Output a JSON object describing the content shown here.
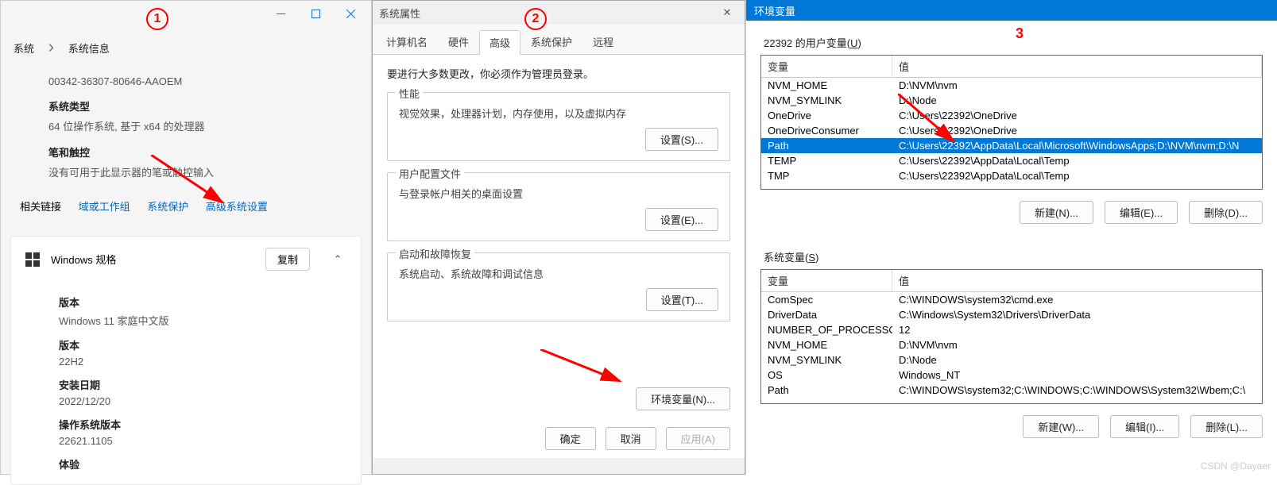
{
  "annotations": {
    "c1": "1",
    "c2": "2",
    "c3": "3"
  },
  "watermark": "CSDN @Dayaer",
  "win1": {
    "breadcrumb_a": "系统",
    "breadcrumb_b": "系统信息",
    "product_id": "00342-36307-80646-AAOEM",
    "type_label": "系统类型",
    "type_value": "64 位操作系统, 基于 x64 的处理器",
    "pen_label": "笔和触控",
    "pen_value": "没有可用于此显示器的笔或触控输入",
    "links_label": "相关链接",
    "link_domain": "域或工作组",
    "link_protect": "系统保护",
    "link_advanced": "高级系统设置",
    "card_title": "Windows 规格",
    "copy": "复制",
    "version_label": "版本",
    "version_value": "Windows 11 家庭中文版",
    "build_label": "版本",
    "build_value": "22H2",
    "date_label": "安装日期",
    "date_value": "2022/12/20",
    "os_label": "操作系统版本",
    "os_value": "22621.1105",
    "exp_label": "体验"
  },
  "win2": {
    "title": "系统属性",
    "tabs": {
      "t1": "计算机名",
      "t2": "硬件",
      "t3": "高级",
      "t4": "系统保护",
      "t5": "远程"
    },
    "admin_note": "要进行大多数更改，你必须作为管理员登录。",
    "perf": {
      "legend": "性能",
      "desc": "视觉效果，处理器计划，内存使用，以及虚拟内存",
      "btn": "设置(S)..."
    },
    "profile": {
      "legend": "用户配置文件",
      "desc": "与登录帐户相关的桌面设置",
      "btn": "设置(E)..."
    },
    "startup": {
      "legend": "启动和故障恢复",
      "desc": "系统启动、系统故障和调试信息",
      "btn": "设置(T)..."
    },
    "env_btn": "环境变量(N)...",
    "ok": "确定",
    "cancel": "取消",
    "apply": "应用(A)"
  },
  "win3": {
    "title": "环境变量",
    "user_label_a": "22392 的用户变量(",
    "user_label_u": "U",
    "user_label_b": ")",
    "th_var": "变量",
    "th_val": "值",
    "user_rows": [
      {
        "var": "NVM_HOME",
        "val": "D:\\NVM\\nvm"
      },
      {
        "var": "NVM_SYMLINK",
        "val": "D:\\Node"
      },
      {
        "var": "OneDrive",
        "val": "C:\\Users\\22392\\OneDrive"
      },
      {
        "var": "OneDriveConsumer",
        "val": "C:\\Users\\22392\\OneDrive"
      },
      {
        "var": "Path",
        "val": "C:\\Users\\22392\\AppData\\Local\\Microsoft\\WindowsApps;D:\\NVM\\nvm;D:\\N"
      },
      {
        "var": "TEMP",
        "val": "C:\\Users\\22392\\AppData\\Local\\Temp"
      },
      {
        "var": "TMP",
        "val": "C:\\Users\\22392\\AppData\\Local\\Temp"
      }
    ],
    "selected_user_row": 4,
    "sys_label_a": "系统变量(",
    "sys_label_s": "S",
    "sys_label_b": ")",
    "sys_rows": [
      {
        "var": "ComSpec",
        "val": "C:\\WINDOWS\\system32\\cmd.exe"
      },
      {
        "var": "DriverData",
        "val": "C:\\Windows\\System32\\Drivers\\DriverData"
      },
      {
        "var": "NUMBER_OF_PROCESSORS",
        "val": "12"
      },
      {
        "var": "NVM_HOME",
        "val": "D:\\NVM\\nvm"
      },
      {
        "var": "NVM_SYMLINK",
        "val": "D:\\Node"
      },
      {
        "var": "OS",
        "val": "Windows_NT"
      },
      {
        "var": "Path",
        "val": "C:\\WINDOWS\\system32;C:\\WINDOWS;C:\\WINDOWS\\System32\\Wbem;C:\\"
      }
    ],
    "new_btn_u": "新建(N)...",
    "edit_btn_u": "编辑(E)...",
    "del_btn_u": "删除(D)...",
    "new_btn_s": "新建(W)...",
    "edit_btn_s": "编辑(I)...",
    "del_btn_s": "删除(L)..."
  }
}
